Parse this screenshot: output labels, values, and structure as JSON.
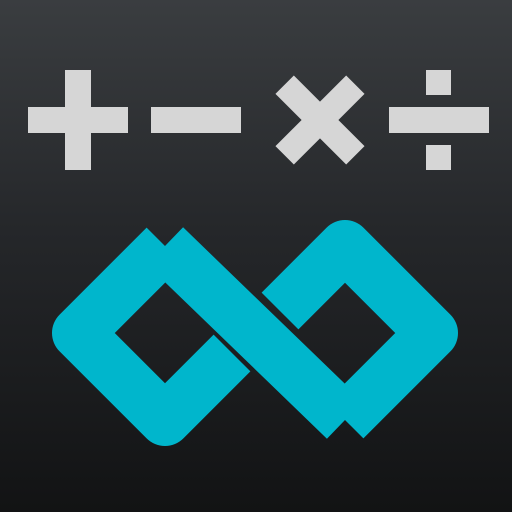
{
  "app_icon": {
    "symbols": [
      "plus-icon",
      "minus-icon",
      "multiply-icon",
      "divide-icon",
      "infinity-icon"
    ],
    "colors": {
      "operator": "#d6d6d6",
      "infinity": "#00b6cc",
      "background_top": "#3a3d40",
      "background_bottom": "#121314"
    }
  }
}
